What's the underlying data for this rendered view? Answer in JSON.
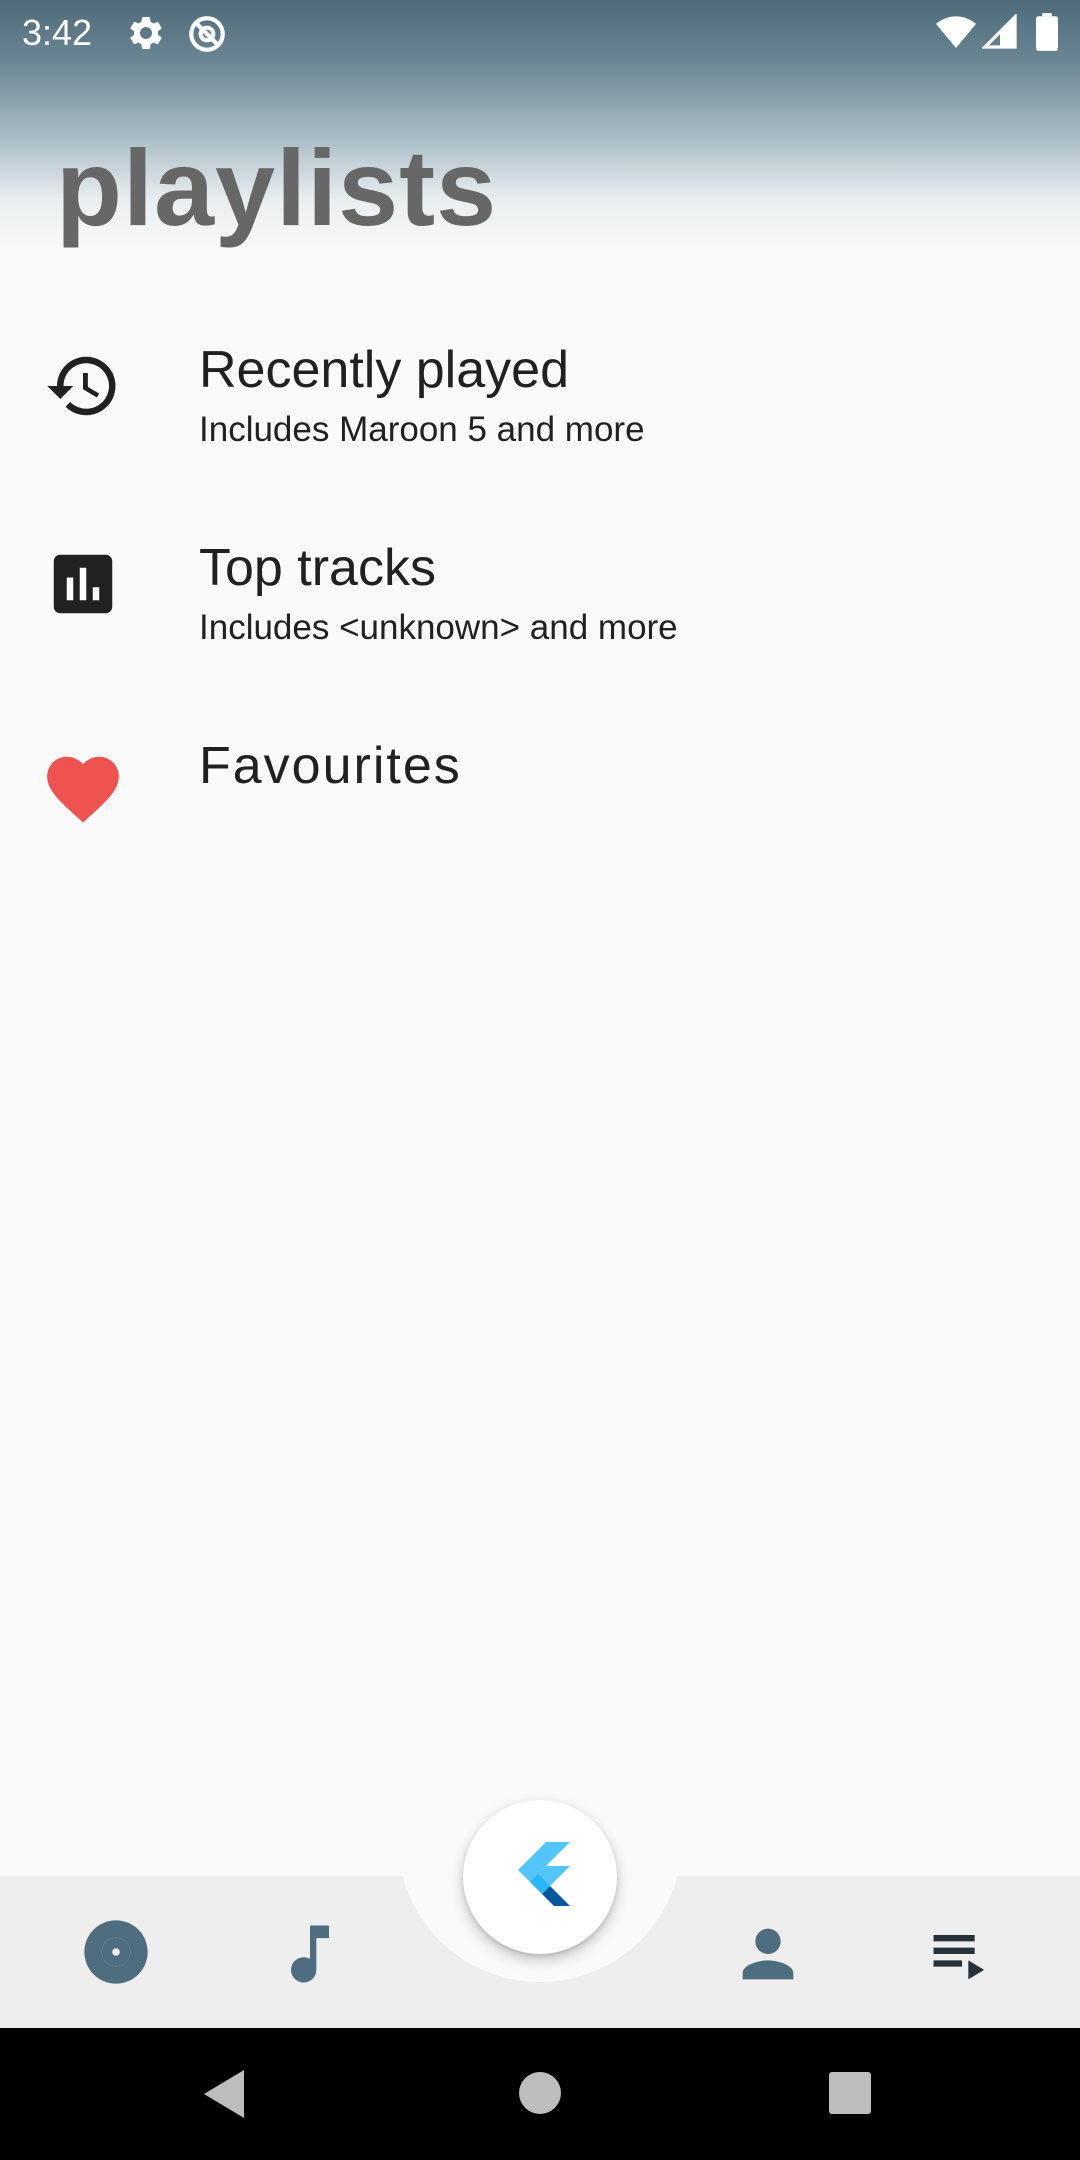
{
  "status_bar": {
    "time": "3:42",
    "left_icons": [
      "gear-icon",
      "no-sync-icon"
    ],
    "right_icons": [
      "wifi-icon",
      "signal-icon",
      "battery-icon"
    ]
  },
  "page": {
    "title": "playlists"
  },
  "playlists": [
    {
      "title": "Recently played",
      "subtitle": "Includes Maroon 5 and more",
      "icon": "history-icon"
    },
    {
      "title": "Top tracks",
      "subtitle": "Includes <unknown> and more",
      "icon": "bar-chart-icon"
    },
    {
      "title": "Favourites",
      "subtitle": "",
      "icon": "heart-icon",
      "icon_color": "#ef5350"
    }
  ],
  "bottom_nav": {
    "items": [
      "album-icon",
      "music-note-icon",
      "flutter-logo",
      "person-icon",
      "queue-music-icon"
    ],
    "accent": "#4e6d7e"
  },
  "system_nav": [
    "back-icon",
    "home-icon",
    "recents-icon"
  ]
}
